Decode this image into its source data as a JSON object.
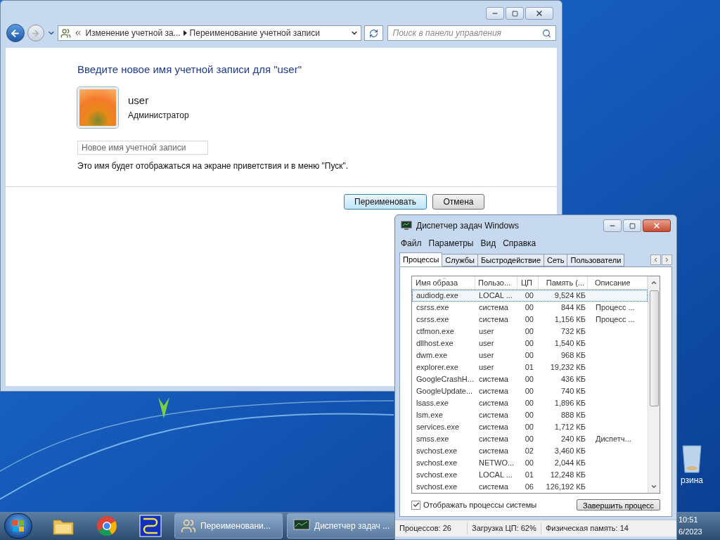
{
  "explorer": {
    "breadcrumbs": [
      "Изменение учетной за...",
      "Переименование учетной записи"
    ],
    "search": {
      "placeholder": "Поиск в панели управления"
    },
    "heading": "Введите новое имя учетной записи для \"user\"",
    "account": {
      "name": "user",
      "role": "Администратор"
    },
    "name_field": {
      "placeholder": "Новое имя учетной записи"
    },
    "hint": "Это имя будет отображаться на экране приветствия и в меню \"Пуск\".",
    "buttons": [
      {
        "label": "Переименовать",
        "default": true
      },
      {
        "label": "Отмена",
        "default": false
      }
    ]
  },
  "task_manager": {
    "title": "Диспетчер задач Windows",
    "menu": [
      "Файл",
      "Параметры",
      "Вид",
      "Справка"
    ],
    "tabs": [
      {
        "label": "Процессы",
        "selected": true
      },
      {
        "label": "Службы",
        "selected": false
      },
      {
        "label": "Быстродействие",
        "selected": false
      },
      {
        "label": "Сеть",
        "selected": false
      },
      {
        "label": "Пользователи",
        "selected": false
      }
    ],
    "columns": [
      "Имя образа",
      "Пользо...",
      "ЦП",
      "Память (...",
      "Описание"
    ],
    "rows": [
      {
        "cells": [
          "audiodg.exe",
          "LOCAL ...",
          "00",
          "9,524 КБ",
          ""
        ],
        "selected": true
      },
      {
        "cells": [
          "csrss.exe",
          "система",
          "00",
          "844 КБ",
          "Процесс ..."
        ],
        "selected": false
      },
      {
        "cells": [
          "csrss.exe",
          "система",
          "00",
          "1,156 КБ",
          "Процесс ..."
        ],
        "selected": false
      },
      {
        "cells": [
          "ctfmon.exe",
          "user",
          "00",
          "732 КБ",
          ""
        ],
        "selected": false
      },
      {
        "cells": [
          "dllhost.exe",
          "user",
          "00",
          "1,540 КБ",
          ""
        ],
        "selected": false
      },
      {
        "cells": [
          "dwm.exe",
          "user",
          "00",
          "968 КБ",
          ""
        ],
        "selected": false
      },
      {
        "cells": [
          "explorer.exe",
          "user",
          "01",
          "19,232 КБ",
          ""
        ],
        "selected": false
      },
      {
        "cells": [
          "GoogleCrashH...",
          "система",
          "00",
          "436 КБ",
          ""
        ],
        "selected": false
      },
      {
        "cells": [
          "GoogleUpdate...",
          "система",
          "00",
          "740 КБ",
          ""
        ],
        "selected": false
      },
      {
        "cells": [
          "lsass.exe",
          "система",
          "00",
          "1,896 КБ",
          ""
        ],
        "selected": false
      },
      {
        "cells": [
          "lsm.exe",
          "система",
          "00",
          "888 КБ",
          ""
        ],
        "selected": false
      },
      {
        "cells": [
          "services.exe",
          "система",
          "00",
          "1,712 КБ",
          ""
        ],
        "selected": false
      },
      {
        "cells": [
          "smss.exe",
          "система",
          "00",
          "240 КБ",
          "Диспетч..."
        ],
        "selected": false
      },
      {
        "cells": [
          "svchost.exe",
          "система",
          "02",
          "3,460 КБ",
          ""
        ],
        "selected": false
      },
      {
        "cells": [
          "svchost.exe",
          "NETWO...",
          "00",
          "2,044 КБ",
          ""
        ],
        "selected": false
      },
      {
        "cells": [
          "svchost.exe",
          "LOCAL ...",
          "01",
          "12,248 КБ",
          ""
        ],
        "selected": false
      },
      {
        "cells": [
          "svchost.exe",
          "система",
          "06",
          "126,192 КБ",
          ""
        ],
        "selected": false
      }
    ],
    "show_all": {
      "label": "Отображать процессы системы",
      "checked": true
    },
    "end_button": "Завершить процесс",
    "status": [
      "Процессов: 26",
      "Загрузка ЦП: 62%",
      "Физическая память: 14"
    ]
  },
  "taskbar": {
    "tasks": [
      "Переименовани...",
      "Диспетчер задач ..."
    ],
    "clock": {
      "time": "10:51",
      "date": "6/2023"
    }
  },
  "desktop": {
    "icons": [
      {
        "label": "рзина"
      }
    ]
  }
}
